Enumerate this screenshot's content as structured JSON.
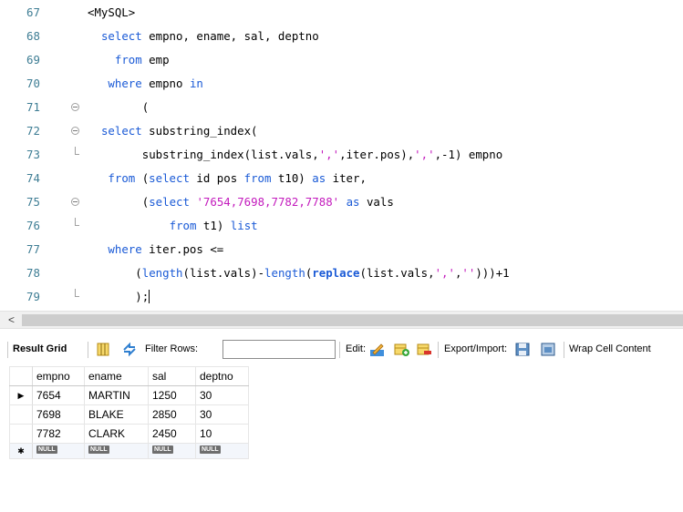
{
  "editor": {
    "lines": [
      {
        "num": "67",
        "fold": "",
        "tokens": [
          {
            "t": "<MySQL>",
            "c": ""
          }
        ],
        "indent": 0
      },
      {
        "num": "68",
        "fold": "",
        "tokens": [
          {
            "t": "select",
            "c": "k"
          },
          {
            "t": " empno, ename, sal, deptno",
            "c": ""
          }
        ],
        "indent": 2
      },
      {
        "num": "69",
        "fold": "",
        "tokens": [
          {
            "t": "from",
            "c": "k"
          },
          {
            "t": " emp",
            "c": ""
          }
        ],
        "indent": 4
      },
      {
        "num": "70",
        "fold": "",
        "tokens": [
          {
            "t": "where",
            "c": "k"
          },
          {
            "t": " empno ",
            "c": ""
          },
          {
            "t": "in",
            "c": "k"
          }
        ],
        "indent": 3
      },
      {
        "num": "71",
        "fold": "open",
        "tokens": [
          {
            "t": "(",
            "c": ""
          }
        ],
        "indent": 8
      },
      {
        "num": "72",
        "fold": "open",
        "tokens": [
          {
            "t": "select",
            "c": "k"
          },
          {
            "t": " substring_index(",
            "c": ""
          }
        ],
        "indent": 2
      },
      {
        "num": "73",
        "fold": "end",
        "tokens": [
          {
            "t": "substring_index(list.vals,",
            "c": ""
          },
          {
            "t": "','",
            "c": "s"
          },
          {
            "t": ",iter.pos),",
            "c": ""
          },
          {
            "t": "','",
            "c": "s"
          },
          {
            "t": ",-1) empno",
            "c": ""
          }
        ],
        "indent": 8
      },
      {
        "num": "74",
        "fold": "",
        "tokens": [
          {
            "t": "from",
            "c": "k"
          },
          {
            "t": " (",
            "c": ""
          },
          {
            "t": "select",
            "c": "k"
          },
          {
            "t": " id pos ",
            "c": ""
          },
          {
            "t": "from",
            "c": "k"
          },
          {
            "t": " t10) ",
            "c": ""
          },
          {
            "t": "as",
            "c": "k"
          },
          {
            "t": " iter,",
            "c": ""
          }
        ],
        "indent": 3
      },
      {
        "num": "75",
        "fold": "open",
        "tokens": [
          {
            "t": "(",
            "c": ""
          },
          {
            "t": "select",
            "c": "k"
          },
          {
            "t": " ",
            "c": ""
          },
          {
            "t": "'7654,7698,7782,7788'",
            "c": "s"
          },
          {
            "t": " ",
            "c": ""
          },
          {
            "t": "as",
            "c": "k"
          },
          {
            "t": " vals",
            "c": ""
          }
        ],
        "indent": 8
      },
      {
        "num": "76",
        "fold": "end",
        "tokens": [
          {
            "t": "from",
            "c": "k"
          },
          {
            "t": " t1) ",
            "c": ""
          },
          {
            "t": "list",
            "c": "k"
          }
        ],
        "indent": 12
      },
      {
        "num": "77",
        "fold": "",
        "tokens": [
          {
            "t": "where",
            "c": "k"
          },
          {
            "t": " iter.pos <=",
            "c": ""
          }
        ],
        "indent": 3
      },
      {
        "num": "78",
        "fold": "",
        "tokens": [
          {
            "t": "(",
            "c": ""
          },
          {
            "t": "length",
            "c": "k"
          },
          {
            "t": "(list.vals)-",
            "c": ""
          },
          {
            "t": "length",
            "c": "k"
          },
          {
            "t": "(",
            "c": ""
          },
          {
            "t": "replace",
            "c": "k b"
          },
          {
            "t": "(list.vals,",
            "c": ""
          },
          {
            "t": "','",
            "c": "s"
          },
          {
            "t": ",",
            "c": ""
          },
          {
            "t": "''",
            "c": "s"
          },
          {
            "t": ")))+1",
            "c": ""
          }
        ],
        "indent": 7
      },
      {
        "num": "79",
        "fold": "end",
        "tokens": [
          {
            "t": ");",
            "c": ""
          }
        ],
        "indent": 7,
        "caret": true
      }
    ]
  },
  "scrollbar": {
    "left_arrow": "<"
  },
  "toolbar": {
    "result_grid_label": "Result Grid",
    "filter_label": "Filter Rows:",
    "filter_value": "",
    "edit_label": "Edit:",
    "export_label": "Export/Import:",
    "wrap_label": "Wrap Cell Content"
  },
  "grid": {
    "columns": [
      "empno",
      "ename",
      "sal",
      "deptno"
    ],
    "rows": [
      [
        "7654",
        "MARTIN",
        "1250",
        "30"
      ],
      [
        "7698",
        "BLAKE",
        "2850",
        "30"
      ],
      [
        "7782",
        "CLARK",
        "2450",
        "10"
      ]
    ],
    "null_label": "NULL",
    "current_row_marker": "▶",
    "new_row_marker": "✱"
  },
  "colors": {
    "keyword": "#1a5ad6",
    "string": "#c31bbd",
    "line_number": "#3e7d94"
  }
}
